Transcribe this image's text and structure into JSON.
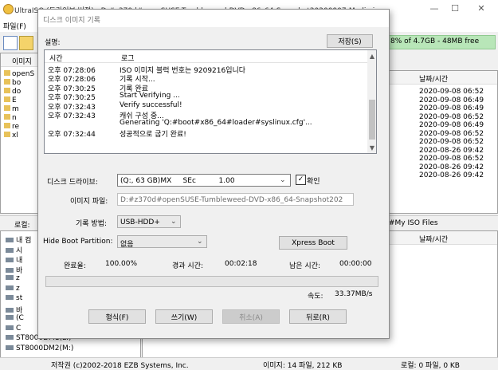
{
  "main": {
    "title": "UltraISO (드라이브 버전) - D:#z370d#openSUSE-Tumbleweed-DVD-x86_64-Snapshot20200907-Media.iso",
    "menu_label": "파일(F)",
    "capacity_text": "8% of 4.7GB - 48MB free",
    "image_pane_label": "이미지",
    "local_pane_label": "로컬:",
    "image_tree": [
      "openS",
      "bo",
      "do",
      "E",
      "m",
      "n",
      "re",
      "xl"
    ],
    "image_date_header": "날짜/시간",
    "image_dates": [
      "2020-09-08 06:52",
      "2020-09-08 06:49",
      "2020-09-08 06:49",
      "2020-09-08 06:52",
      "2020-09-08 06:49",
      "2020-09-08 06:52",
      "2020-09-08 06:52",
      "2020-08-26 09:42",
      "2020-09-08 06:52",
      "2020-08-26 09:42",
      "2020-08-26 09:42"
    ],
    "local_path": "#My ISO Files",
    "local_date_header": "날짜/시간",
    "local_tree": [
      "내 컴",
      "시",
      "내",
      "바",
      "z",
      "z",
      "st",
      "바",
      "(C",
      "C",
      "ST8000DM1(L:)",
      "ST8000DM2(M:)"
    ],
    "status_copyright": "저작권 (c)2002-2018 EZB Systems, Inc.",
    "status_image": "이미지: 14 파일, 212 KB",
    "status_local": "로컬: 0 파일, 0 KB"
  },
  "dialog": {
    "title": "디스크 이미지 기록",
    "message_label": "설명:",
    "save_label": "저장(S)",
    "log_headers": {
      "time": "시간",
      "log": "로그"
    },
    "log": [
      {
        "time": "오후 07:28:06",
        "msg": "ISO 이미지 블럭 번호는 9209216입니다"
      },
      {
        "time": "오후 07:28:06",
        "msg": "기록 시작..."
      },
      {
        "time": "오후 07:30:25",
        "msg": "기록 완료"
      },
      {
        "time": "오후 07:30:25",
        "msg": "Start Verifying ..."
      },
      {
        "time": "오후 07:32:43",
        "msg": "Verify successful!"
      },
      {
        "time": "오후 07:32:43",
        "msg": "캐쉬 구성 중..."
      },
      {
        "time": "",
        "msg": "Generating 'Q:#boot#x86_64#loader#syslinux.cfg'..."
      },
      {
        "time": "오후 07:32:44",
        "msg": "성공적으로 굽기 완료!"
      }
    ],
    "drive_label": "디스크 드라이브:",
    "drive_value": "(Q:, 63 GB)MX     SEc          1.00",
    "verify_label": "확인",
    "verify_checked": true,
    "image_file_label": "이미지 파일:",
    "image_file_value": "D:#z370d#openSUSE-Tumbleweed-DVD-x86_64-Snapshot202",
    "write_method_label": "기록 방법:",
    "write_method_value": "USB-HDD+",
    "hide_boot_label": "Hide Boot Partition:",
    "hide_boot_value": "없음",
    "xpress_label": "Xpress Boot",
    "completed_label": "완료율:",
    "completed_value": "100.00%",
    "elapsed_label": "경과 시간:",
    "elapsed_value": "00:02:18",
    "remaining_label": "남은 시간:",
    "remaining_value": "00:00:00",
    "progress": 1.0,
    "speed_label": "속도:",
    "speed_value": "33.37MB/s",
    "btn_format": "형식(F)",
    "btn_write": "쓰기(W)",
    "btn_cancel": "취소(A)",
    "btn_back": "뒤로(R)"
  },
  "colors": {
    "capacity_bar": "#b8e6b8",
    "progress_track": "#e6e6e6"
  }
}
